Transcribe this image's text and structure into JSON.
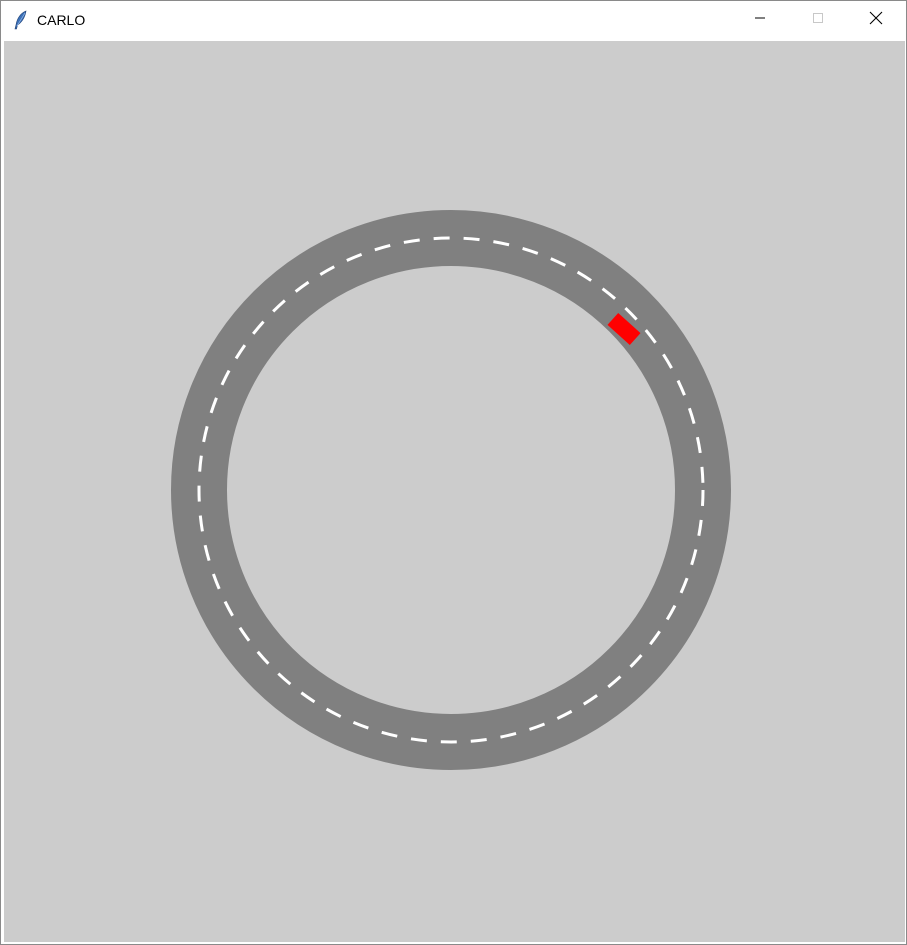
{
  "window": {
    "title": "CARLO",
    "icons": {
      "app": "feather-icon",
      "minimize": "minimize-icon",
      "maximize": "maximize-icon",
      "close": "close-icon"
    }
  },
  "scene": {
    "background_color": "#cccccc",
    "track": {
      "shape": "ring",
      "color": "#808080",
      "center_line": "dashed",
      "center_line_color": "#ffffff"
    },
    "car": {
      "color": "#ff0000",
      "count": 1
    }
  }
}
